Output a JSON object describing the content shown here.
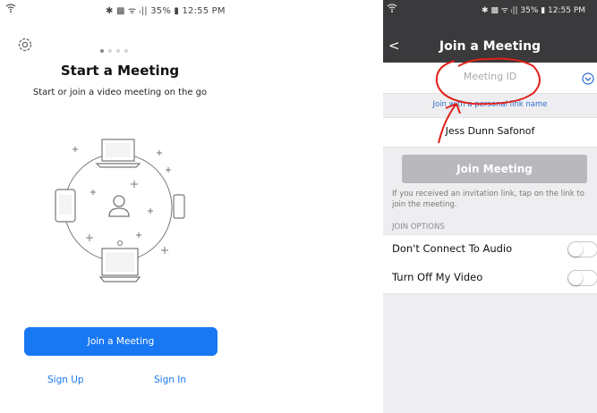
{
  "left": {
    "status_bar": {
      "icons_left": "wifi",
      "right_text": "✱ ▩ ᯤ ᵢ|| 35% ▮ 12:55 PM"
    },
    "pager": {
      "count": 4,
      "active": 0
    },
    "title": "Start a Meeting",
    "subtitle": "Start or join a video meeting on the go",
    "join_button": "Join a Meeting",
    "sign_up": "Sign Up",
    "sign_in": "Sign In",
    "colors": {
      "accent": "#1877f2"
    }
  },
  "right": {
    "status_bar": {
      "right_text": "✱ ▩ ᯤ ᵢ|| 35% ▮ 12:55 PM"
    },
    "back": "<",
    "title": "Join a Meeting",
    "meeting_id_placeholder": "Meeting ID",
    "personal_link": "Join with a personal link name",
    "name": "Jess Dunn Safonof",
    "join_button": "Join Meeting",
    "hint": "If you received an invitation link, tap on the link to join the meeting.",
    "join_options_header": "JOIN OPTIONS",
    "options": [
      {
        "label": "Don't Connect To Audio",
        "on": false
      },
      {
        "label": "Turn Off My Video",
        "on": false
      }
    ],
    "colors": {
      "header_bg": "#3a3a3c",
      "annotation": "#e0211a"
    }
  }
}
